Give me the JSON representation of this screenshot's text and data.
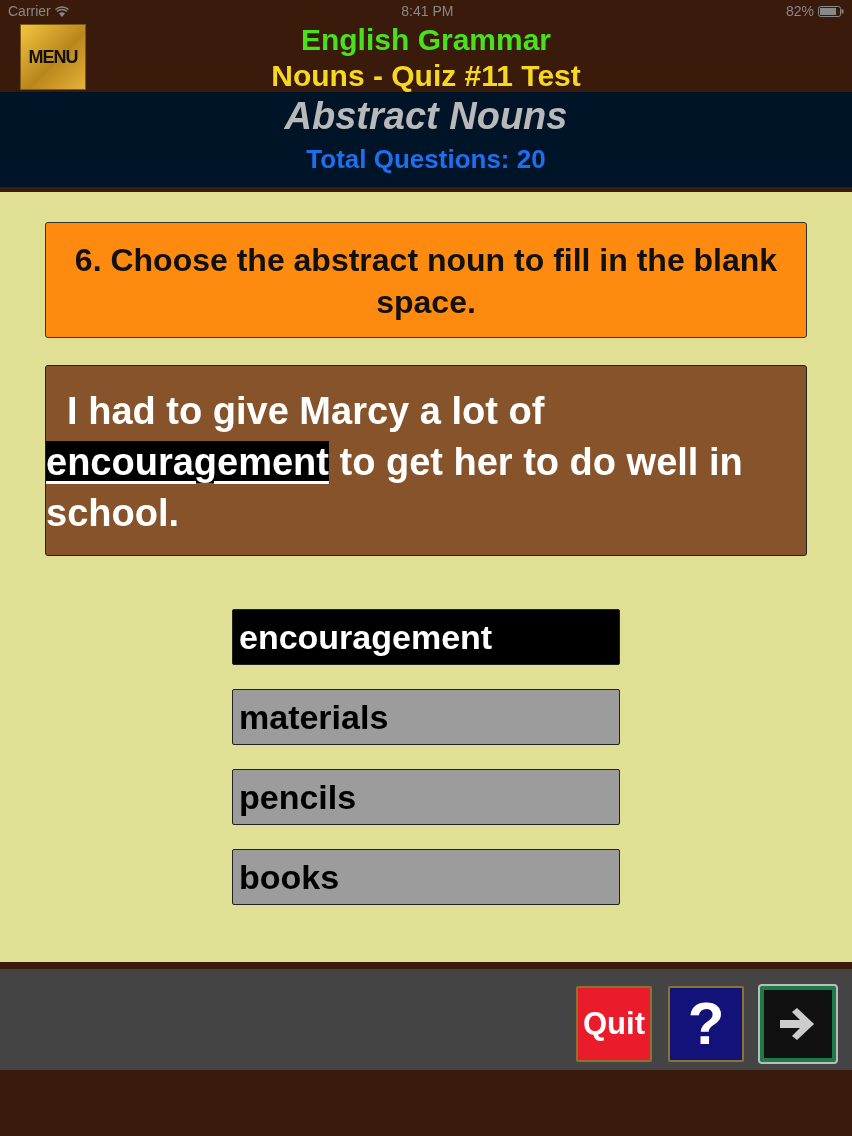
{
  "status_bar": {
    "carrier": "Carrier",
    "time": "8:41 PM",
    "battery": "82%"
  },
  "header": {
    "menu_label": "MENU",
    "app_title": "English Grammar",
    "quiz_title": "Nouns - Quiz #11 Test"
  },
  "topic": {
    "title": "Abstract Nouns",
    "total": "Total Questions: 20"
  },
  "question": {
    "prompt": "6. Choose the abstract noun to fill in the blank space.",
    "sentence_before": " I had to give Marcy a lot of",
    "blank": "encouragement",
    "sentence_after": "to get her to do well in school."
  },
  "answers": [
    {
      "label": "encouragement",
      "selected": true
    },
    {
      "label": "materials",
      "selected": false
    },
    {
      "label": "pencils",
      "selected": false
    },
    {
      "label": "books",
      "selected": false
    }
  ],
  "toolbar": {
    "quit": "Quit",
    "help": "?"
  }
}
